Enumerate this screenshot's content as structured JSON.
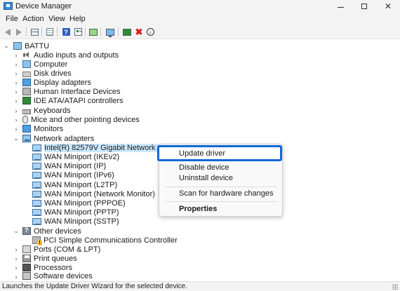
{
  "window": {
    "title": "Device Manager"
  },
  "menu": [
    "File",
    "Action",
    "View",
    "Help"
  ],
  "toolbar": {
    "icons": [
      "back-arrow-icon",
      "forward-arrow-icon",
      "show-hide-console-tree-icon",
      "properties-sheet-icon",
      "help-icon",
      "device-properties-icon",
      "monitor-icon",
      "scan-hardware-icon",
      "update-driver-icon",
      "uninstall-device-icon",
      "disable-device-icon"
    ]
  },
  "tree": {
    "root": "BATTU",
    "items": [
      {
        "label": "Audio inputs and outputs",
        "icon": "audio-icon",
        "expanded": false
      },
      {
        "label": "Computer",
        "icon": "computer-icon",
        "expanded": false
      },
      {
        "label": "Disk drives",
        "icon": "disk-drive-icon",
        "expanded": false
      },
      {
        "label": "Display adapters",
        "icon": "display-adapter-icon",
        "expanded": false
      },
      {
        "label": "Human Interface Devices",
        "icon": "hid-icon",
        "expanded": false
      },
      {
        "label": "IDE ATA/ATAPI controllers",
        "icon": "ide-controller-icon",
        "expanded": false
      },
      {
        "label": "Keyboards",
        "icon": "keyboard-icon",
        "expanded": false
      },
      {
        "label": "Mice and other pointing devices",
        "icon": "mouse-icon",
        "expanded": false
      },
      {
        "label": "Monitors",
        "icon": "monitor-icon",
        "expanded": false
      },
      {
        "label": "Network adapters",
        "icon": "network-adapter-icon",
        "expanded": true,
        "children": [
          "Intel(R) 82579V Gigabit Network Connectio",
          "WAN Miniport (IKEv2)",
          "WAN Miniport (IP)",
          "WAN Miniport (IPv6)",
          "WAN Miniport (L2TP)",
          "WAN Miniport (Network Monitor)",
          "WAN Miniport (PPPOE)",
          "WAN Miniport (PPTP)",
          "WAN Miniport (SSTP)"
        ]
      },
      {
        "label": "Other devices",
        "icon": "other-devices-icon",
        "expanded": true,
        "children": [
          "PCI Simple Communications Controller"
        ]
      },
      {
        "label": "Ports (COM & LPT)",
        "icon": "ports-icon",
        "expanded": false
      },
      {
        "label": "Print queues",
        "icon": "printer-icon",
        "expanded": false
      },
      {
        "label": "Processors",
        "icon": "processor-icon",
        "expanded": false
      },
      {
        "label": "Software devices",
        "icon": "software-device-icon",
        "expanded": false
      }
    ]
  },
  "context_menu": {
    "update_driver": "Update driver",
    "disable_device": "Disable device",
    "uninstall_device": "Uninstall device",
    "scan": "Scan for hardware changes",
    "properties": "Properties"
  },
  "status_bar": {
    "text": "Launches the Update Driver Wizard for the selected device."
  },
  "colors": {
    "highlight_border": "#1068d8",
    "selection": "#cce8ff"
  }
}
